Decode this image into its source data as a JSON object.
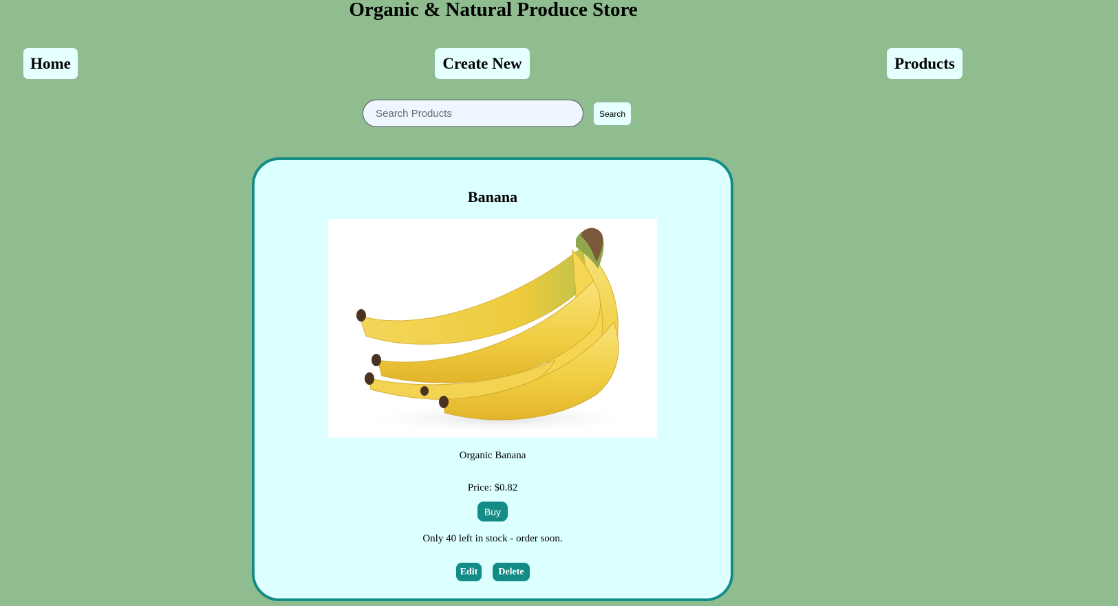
{
  "header": {
    "title": "Organic & Natural Produce Store"
  },
  "nav": {
    "home": "Home",
    "create_new": "Create New",
    "products": "Products"
  },
  "search": {
    "placeholder": "Search Products",
    "value": "",
    "button_label": "Search"
  },
  "product": {
    "name": "Banana",
    "description": "Organic Banana",
    "price": "Price: $0.82",
    "buy_label": "Buy",
    "stock_note": "Only 40 left in stock - order soon.",
    "edit_label": "Edit",
    "delete_label": "Delete",
    "image_subject": "banana-bunch"
  },
  "colors": {
    "page_background": "#8fbd8f",
    "card_background": "#dcffff",
    "accent": "#138b86",
    "nav_button": "#e6ffff"
  }
}
